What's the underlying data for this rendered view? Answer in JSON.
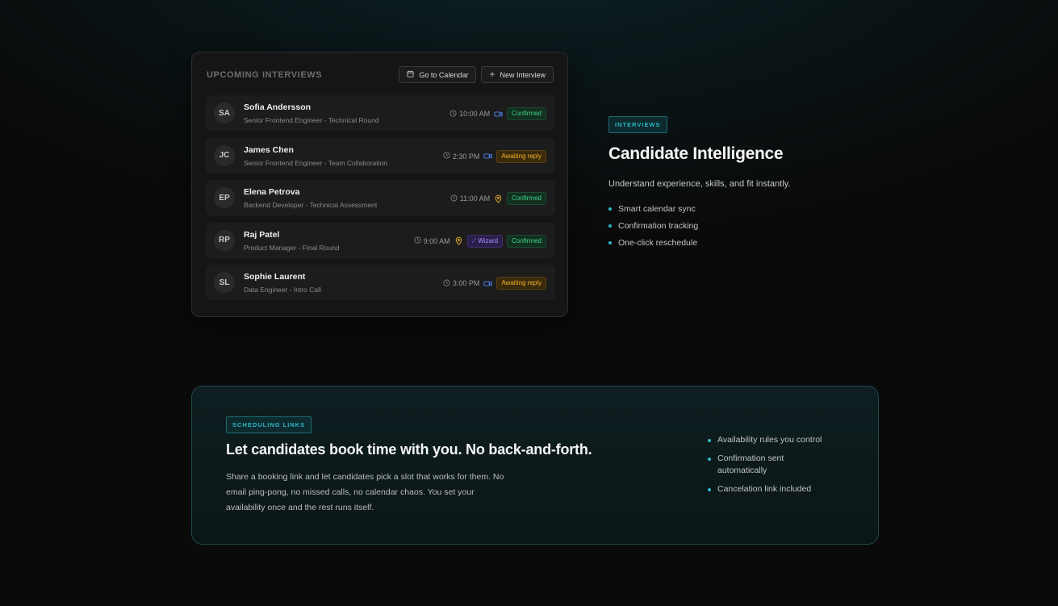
{
  "interviews_card": {
    "title": "UPCOMING INTERVIEWS",
    "go_to_calendar": "Go to Calendar",
    "new_interview": "New Interview",
    "rows": [
      {
        "initials": "SA",
        "name": "Sofia Andersson",
        "role": "Senior Frontend Engineer - Technical Round",
        "time": "10:00 AM",
        "icon": "video-icon",
        "status": "Confirmed"
      },
      {
        "initials": "JC",
        "name": "James Chen",
        "role": "Senior Frontend Engineer - Team Collaboration",
        "time": "2:30 PM",
        "icon": "video-icon",
        "status": "Awaiting reply"
      },
      {
        "initials": "EP",
        "name": "Elena Petrova",
        "role": "Backend Developer - Technical Assessment",
        "time": "11:00 AM",
        "icon": "location-pin-icon",
        "status": "Confirmed"
      },
      {
        "initials": "RP",
        "name": "Raj Patel",
        "role": "Product Manager - Final Round",
        "time": "9:00 AM",
        "icon": "location-pin-icon",
        "extra_badge": "Wizard",
        "status": "Confirmed"
      },
      {
        "initials": "SL",
        "name": "Sophie Laurent",
        "role": "Data Engineer - Intro Call",
        "time": "3:00 PM",
        "icon": "video-icon",
        "status": "Awaiting reply"
      }
    ]
  },
  "interviews_section": {
    "tag": "INTERVIEWS",
    "title": "Candidate Intelligence",
    "subtitle": "Understand experience, skills, and fit instantly.",
    "bullets": [
      "Smart calendar sync",
      "Confirmation tracking",
      "One-click reschedule"
    ]
  },
  "scheduling": {
    "tag": "SCHEDULING LINKS",
    "title": "Let candidates book time with you. No back-and-forth.",
    "body": "Share a booking link and let candidates pick a slot that works for them. No email ping-pong, no missed calls, no calendar chaos. You set your availability once and the rest runs itself.",
    "bullets": [
      "Availability rules you control",
      "Confirmation sent automatically",
      "Cancelation link included"
    ]
  },
  "colors": {
    "accent": "#2fb8c6",
    "confirmed": "#3fd58a",
    "awaiting": "#f0b429",
    "wizard": "#a98bff",
    "video": "#4b8df8",
    "pin": "#f0b429"
  }
}
